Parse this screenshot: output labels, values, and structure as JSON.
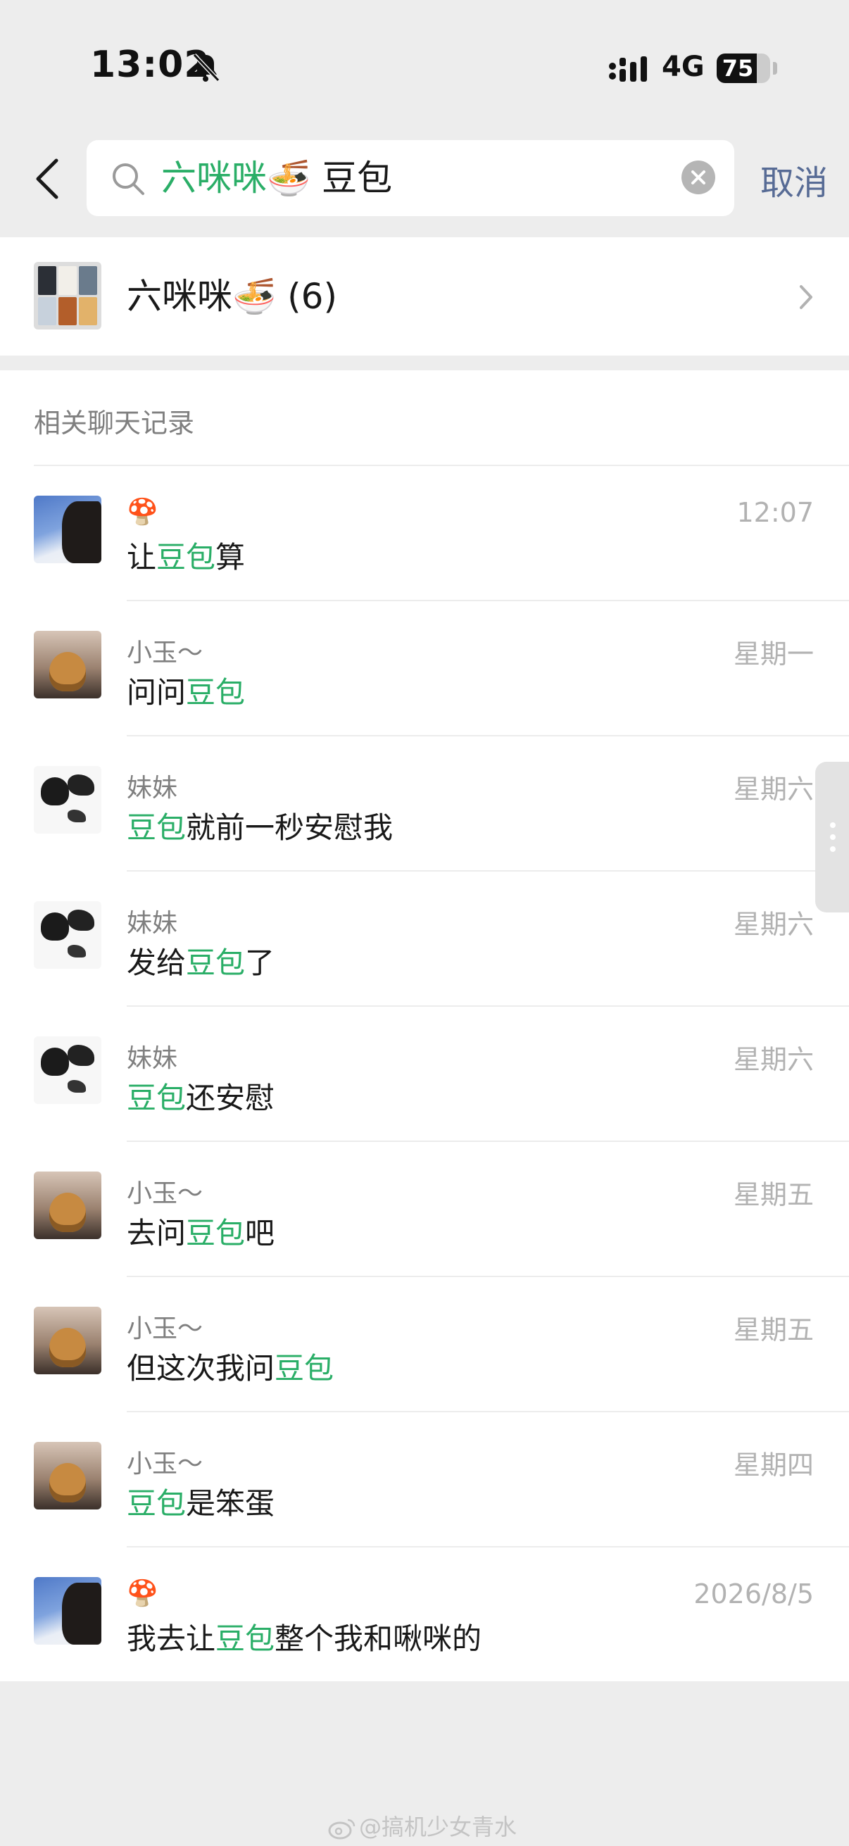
{
  "status_bar": {
    "time": "13:02",
    "network": "4G",
    "battery_text": "75",
    "battery_level": 0.75,
    "icons": [
      "bell-muted-icon",
      "signal-icon"
    ]
  },
  "search": {
    "query_group_part": "六咪咪🍜",
    "query_keyword": "豆包",
    "cancel_label": "取消",
    "icons": [
      "back-icon",
      "search-icon",
      "clear-icon"
    ]
  },
  "group": {
    "name": "六咪咪🍜",
    "count": "(6)",
    "avatar_colors": [
      "#2b2f36",
      "#f2efe9",
      "#6a7b8c",
      "#c7d1dc",
      "#b35e2a",
      "#e2b26a"
    ]
  },
  "section": {
    "title": "相关聊天记录"
  },
  "highlight_color": "#2aae67",
  "results": [
    {
      "avatar": "sky",
      "sender": "🍄",
      "time": "12:07",
      "parts": [
        {
          "t": "让",
          "hl": false
        },
        {
          "t": "豆包",
          "hl": true
        },
        {
          "t": "算",
          "hl": false
        }
      ]
    },
    {
      "avatar": "cat",
      "sender": "小玉～",
      "time": "星期一",
      "parts": [
        {
          "t": "问问",
          "hl": false
        },
        {
          "t": "豆包",
          "hl": true
        }
      ]
    },
    {
      "avatar": "cartoon",
      "sender": "妹妹",
      "time": "星期六",
      "parts": [
        {
          "t": "豆包",
          "hl": true
        },
        {
          "t": "就前一秒安慰我",
          "hl": false
        }
      ]
    },
    {
      "avatar": "cartoon",
      "sender": "妹妹",
      "time": "星期六",
      "parts": [
        {
          "t": "发给",
          "hl": false
        },
        {
          "t": "豆包",
          "hl": true
        },
        {
          "t": "了",
          "hl": false
        }
      ]
    },
    {
      "avatar": "cartoon",
      "sender": "妹妹",
      "time": "星期六",
      "parts": [
        {
          "t": "豆包",
          "hl": true
        },
        {
          "t": "还安慰",
          "hl": false
        }
      ]
    },
    {
      "avatar": "cat",
      "sender": "小玉～",
      "time": "星期五",
      "parts": [
        {
          "t": "去问",
          "hl": false
        },
        {
          "t": "豆包",
          "hl": true
        },
        {
          "t": "吧",
          "hl": false
        }
      ]
    },
    {
      "avatar": "cat",
      "sender": "小玉～",
      "time": "星期五",
      "parts": [
        {
          "t": "但这次我问",
          "hl": false
        },
        {
          "t": "豆包",
          "hl": true
        }
      ]
    },
    {
      "avatar": "cat",
      "sender": "小玉～",
      "time": "星期四",
      "parts": [
        {
          "t": "豆包",
          "hl": true
        },
        {
          "t": "是笨蛋",
          "hl": false
        }
      ]
    },
    {
      "avatar": "sky",
      "sender": "🍄",
      "time": "2026/8/5",
      "parts": [
        {
          "t": "我去让",
          "hl": false
        },
        {
          "t": "豆包",
          "hl": true
        },
        {
          "t": "整个我和啾咪的",
          "hl": false
        }
      ]
    }
  ],
  "watermark": {
    "text": "@搞机少女青水",
    "icon": "weibo-icon"
  }
}
